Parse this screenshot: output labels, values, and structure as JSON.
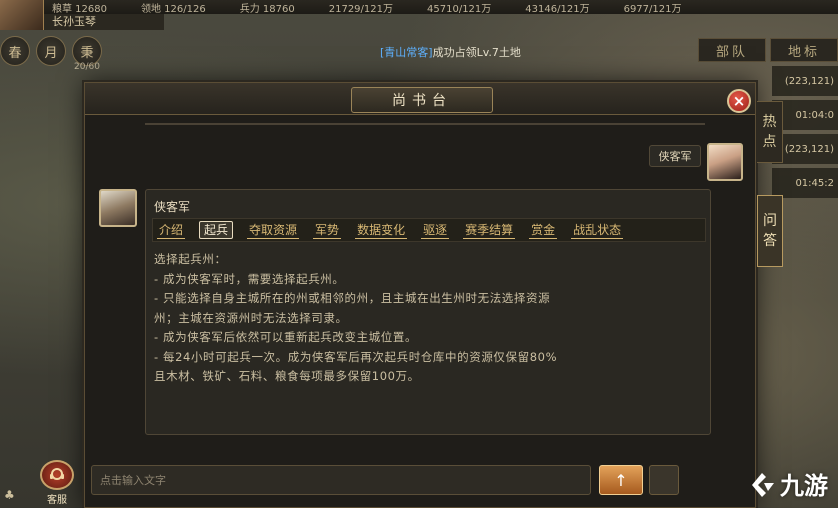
{
  "topbar": {
    "stats": [
      "粮草 12680",
      "领地 126/126",
      "兵力 18760",
      "21729/121万",
      "45710/121万",
      "43146/121万",
      "6977/121万"
    ],
    "player_name": "长孙玉琴"
  },
  "seasons": [
    "春",
    "月",
    "秉"
  ],
  "season_count": "20/60",
  "notice": {
    "who": "[青山常客]",
    "message": "成功占领Lv.7土地"
  },
  "right_panel": {
    "tabs": [
      "部队",
      "地标"
    ],
    "items": [
      "(223,121)",
      "01:04:0",
      "(223,121)",
      "01:45:2"
    ]
  },
  "dialog": {
    "title": "尚书台",
    "close_symbol": "×",
    "side_tabs": {
      "hot": [
        "热",
        "点"
      ],
      "qa": [
        "问",
        "答"
      ]
    },
    "user_message": "侠客军",
    "answer": {
      "title": "侠客军",
      "tabs": [
        "介绍",
        "起兵",
        "夺取资源",
        "军势",
        "数据变化",
        "驱逐",
        "赛季结算",
        "赏金",
        "战乱状态"
      ],
      "active_tab": "起兵",
      "lines": [
        "选择起兵州：",
        "- 成为侠客军时，需要选择起兵州。",
        "- 只能选择自身主城所在的州或相邻的州，且主城在出生州时无法选择资源",
        "州；主城在资源州时无法选择司隶。",
        "- 成为侠客军后依然可以重新起兵改变主城位置。",
        "- 每24小时可起兵一次。成为侠客军后再次起兵时仓库中的资源仅保留80%",
        "且木材、铁矿、石料、粮食每项最多保留100万。"
      ]
    },
    "input": {
      "placeholder": "点击输入文字"
    },
    "send_symbol": "↑"
  },
  "service": {
    "label": "客服"
  },
  "watermark": {
    "text": "九游"
  },
  "icons": {
    "close": "close-icon",
    "send": "arrow-up-icon",
    "service": "customer-service-icon",
    "watermark": "jiuyou-logo-icon"
  },
  "colors": {
    "accent_gold": "#d8b874",
    "close_red": "#c0392b",
    "send_orange": "#e3a25a",
    "link_blue": "#5fb2ff"
  }
}
